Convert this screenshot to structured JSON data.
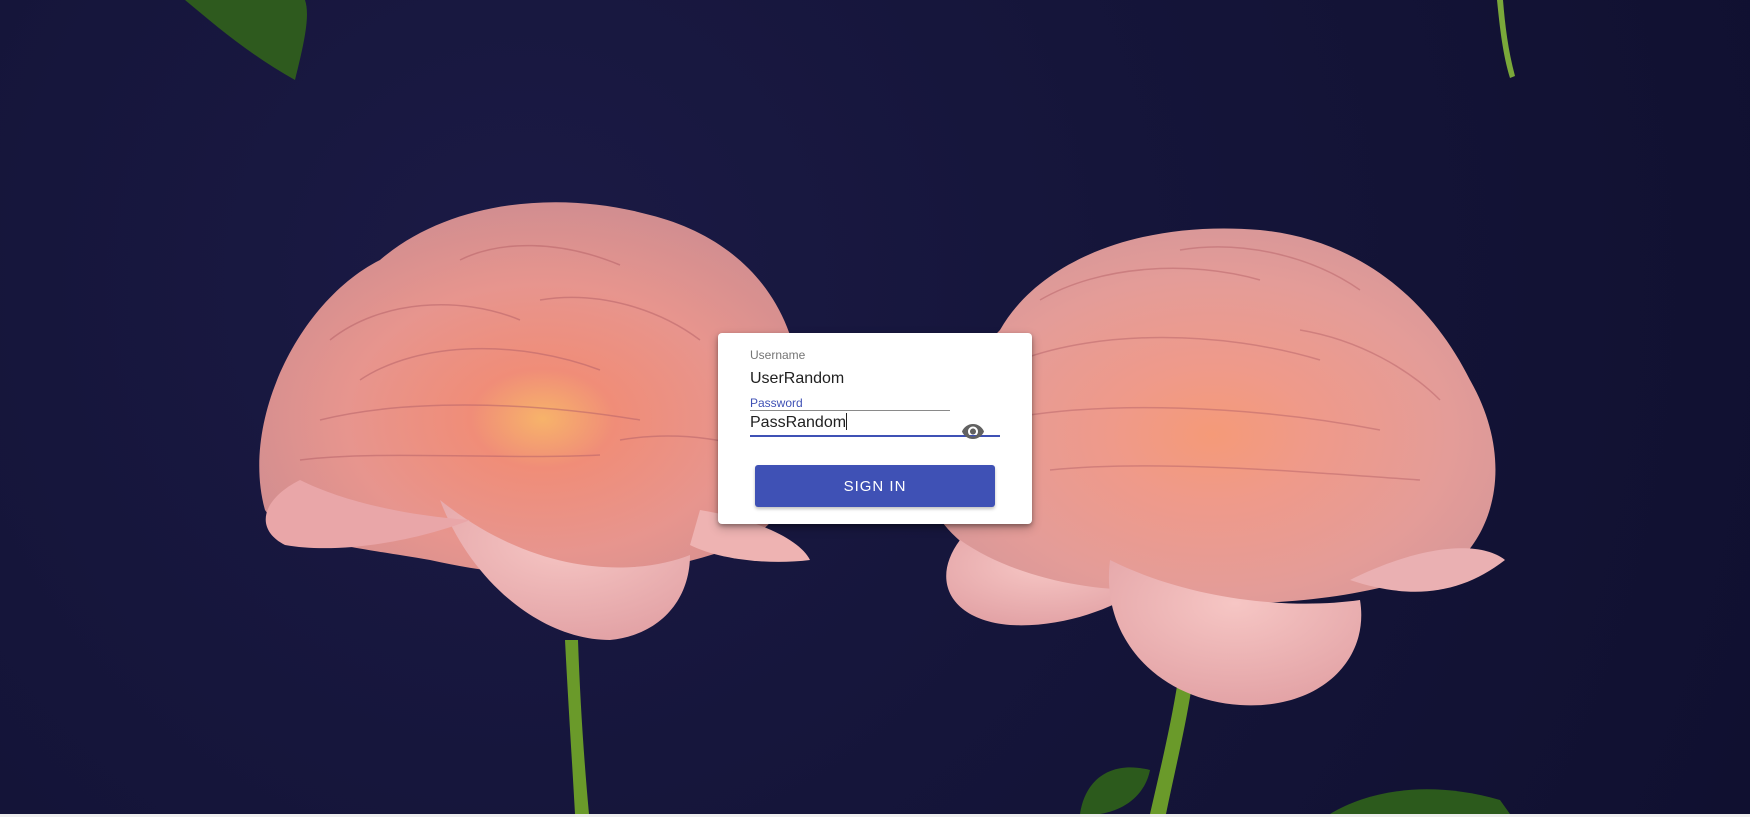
{
  "login": {
    "username_label": "Username",
    "username_value": "UserRandom",
    "password_label": "Password",
    "password_value": "PassRandom",
    "signin_label": "SIGN IN"
  },
  "icons": {
    "visibility_toggle": "eye-icon"
  },
  "colors": {
    "accent": "#3f51b5",
    "background_fabric": "#15153a",
    "rose_pink": "#e89a92",
    "stem_green": "#6a9a2a"
  }
}
